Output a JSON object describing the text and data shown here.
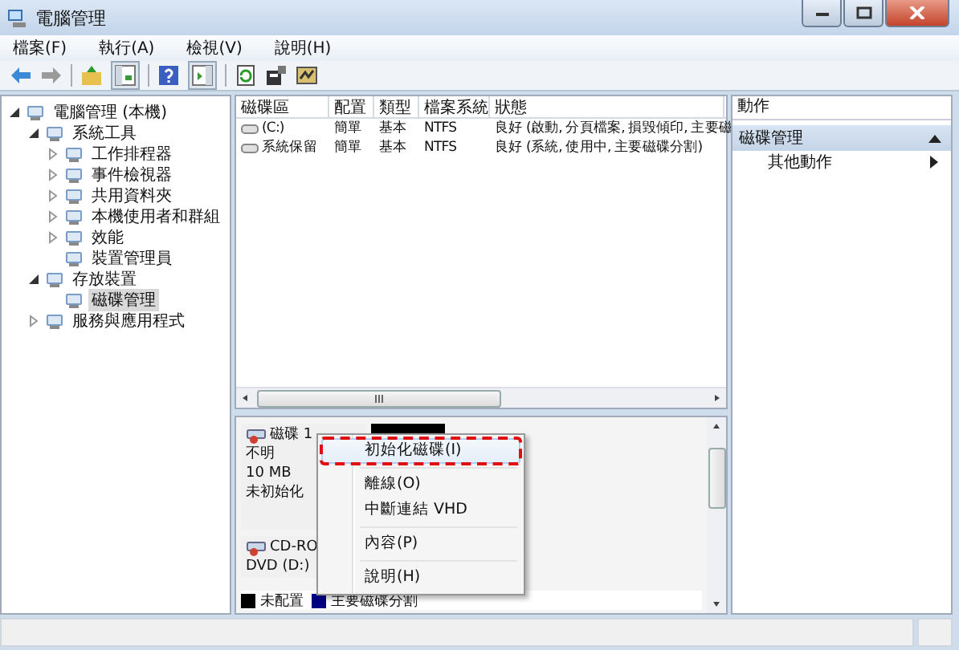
{
  "window": {
    "title": "電腦管理"
  },
  "menu": [
    "檔案(F)",
    "執行(A)",
    "檢視(V)",
    "說明(H)"
  ],
  "tree": [
    {
      "label": "電腦管理 (本機)",
      "expanded": true,
      "selected": false,
      "children": [
        {
          "label": "系統工具",
          "expanded": true,
          "selected": false,
          "children": [
            {
              "label": "工作排程器",
              "expanded": false,
              "selected": false
            },
            {
              "label": "事件檢視器",
              "expanded": false,
              "selected": false
            },
            {
              "label": "共用資料夾",
              "expanded": false,
              "selected": false
            },
            {
              "label": "本機使用者和群組",
              "expanded": false,
              "selected": false
            },
            {
              "label": "效能",
              "expanded": false,
              "selected": false
            },
            {
              "label": "裝置管理員",
              "selected": false
            }
          ]
        },
        {
          "label": "存放裝置",
          "expanded": true,
          "selected": false,
          "children": [
            {
              "label": "磁碟管理",
              "selected": true
            }
          ]
        },
        {
          "label": "服務與應用程式",
          "expanded": false,
          "selected": false
        }
      ]
    }
  ],
  "table": {
    "columns": [
      "磁碟區",
      "配置",
      "類型",
      "檔案系統",
      "狀態"
    ],
    "rows": [
      [
        "(C:)",
        "簡單",
        "基本",
        "NTFS",
        "良好 (啟動, 分頁檔案, 損毀傾印, 主要磁"
      ],
      [
        "系統保留",
        "簡單",
        "基本",
        "NTFS",
        "良好 (系統, 使用中, 主要磁碟分割)"
      ]
    ]
  },
  "disks": [
    {
      "name": "磁碟 1",
      "lines": [
        "不明",
        "10 MB",
        "未初始化"
      ]
    },
    {
      "name": "CD-RO",
      "lines": [
        "DVD (D:)"
      ]
    }
  ],
  "legend": [
    {
      "label": "未配置",
      "color": "#000000"
    },
    {
      "label": "主要磁碟分割",
      "color": "#000080"
    }
  ],
  "context_menu": [
    {
      "kind": "item",
      "label": "初始化磁碟(I)",
      "selected": true,
      "annotated": true
    },
    {
      "kind": "separator"
    },
    {
      "kind": "item",
      "label": "離線(O)",
      "selected": false,
      "annotated": false
    },
    {
      "kind": "item",
      "label": "中斷連結 VHD",
      "selected": false,
      "annotated": false
    },
    {
      "kind": "separator"
    },
    {
      "kind": "item",
      "label": "內容(P)",
      "selected": false,
      "annotated": false
    },
    {
      "kind": "separator"
    },
    {
      "kind": "item",
      "label": "說明(H)",
      "selected": false,
      "annotated": false
    }
  ],
  "actions": {
    "title": "動作",
    "section": "磁碟管理",
    "items": [
      "其他動作"
    ]
  }
}
